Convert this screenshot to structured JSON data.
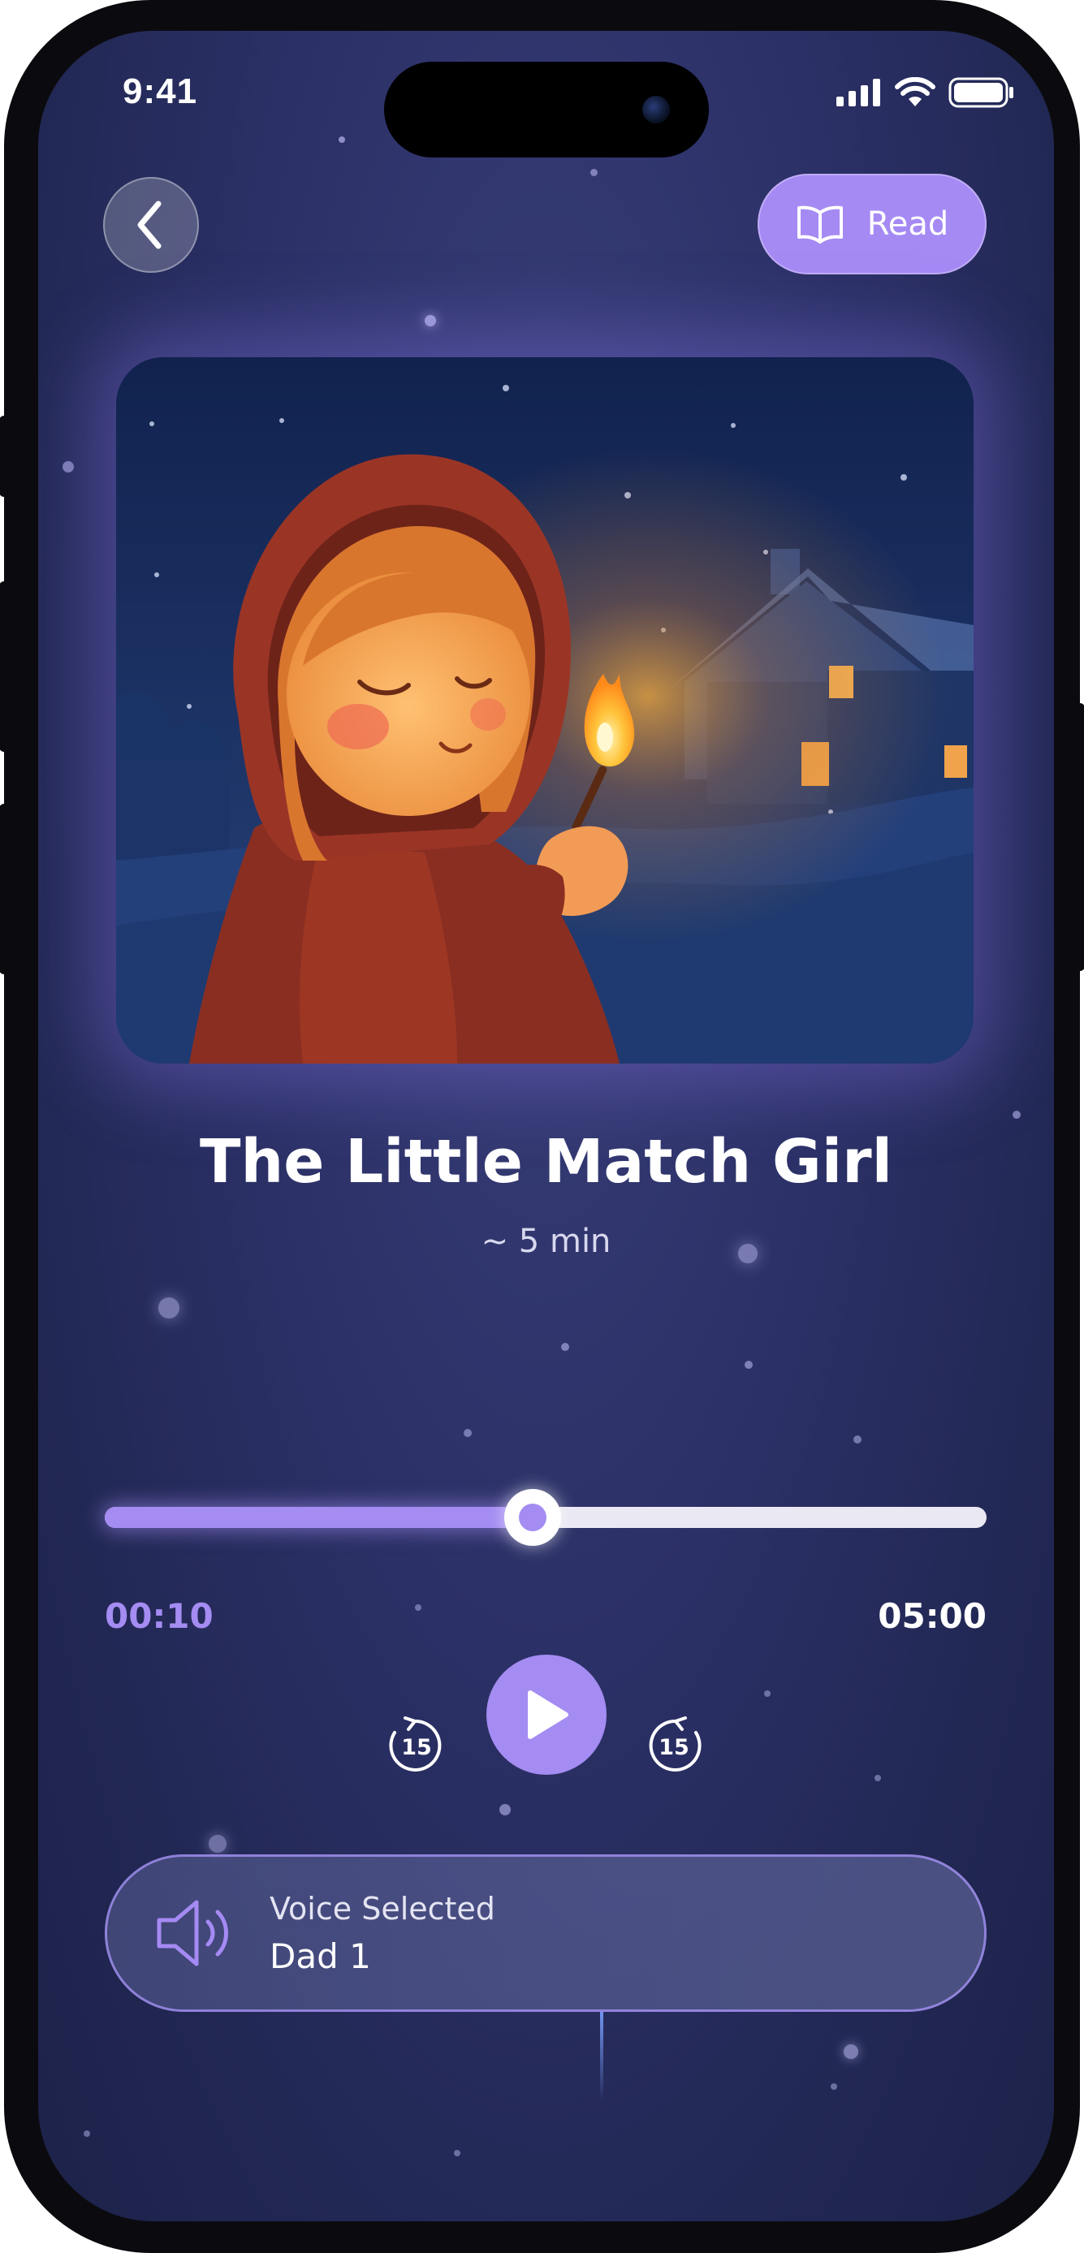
{
  "status_bar": {
    "time": "9:41",
    "icons": [
      "signal-icon",
      "wifi-icon",
      "battery-icon"
    ]
  },
  "header": {
    "back_icon": "chevron-left-icon",
    "read_icon": "book-open-icon",
    "read_label": "Read"
  },
  "story": {
    "title": "The Little Match Girl",
    "duration": "~ 5 min",
    "cover_description_icon": "match-girl-illustration"
  },
  "player": {
    "current_time": "00:10",
    "total_time": "05:00",
    "progress": 0.485,
    "rewind_label": "15",
    "forward_label": "15",
    "play_icon": "play-icon"
  },
  "voice": {
    "icon": "speaker-icon",
    "label": "Voice Selected",
    "name": "Dad 1"
  },
  "colors": {
    "accent": "#a58af4",
    "background": "#2b3066",
    "track": "#e9e8f3"
  }
}
